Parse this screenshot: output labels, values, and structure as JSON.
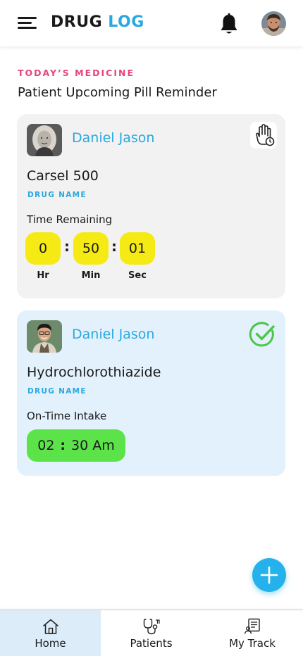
{
  "header": {
    "logo_word1": "DRUG",
    "logo_word2": "LOG",
    "menu_icon": "hamburger-icon",
    "notification_icon": "bell-icon",
    "profile_icon": "user-avatar"
  },
  "section": {
    "kicker": "TODAY’S MEDICINE",
    "title": "Patient Upcoming Pill Reminder"
  },
  "reminders": [
    {
      "patient_name": "Daniel Jason",
      "drug_name": "Carsel 500",
      "drug_label": "DRUG NAME",
      "status_label": "Time Remaining",
      "action_icon": "hand-clock-icon",
      "timer": {
        "hours": "0",
        "minutes": "50",
        "seconds": "01",
        "separator": ":",
        "hours_label": "Hr",
        "minutes_label": "Min",
        "seconds_label": "Sec"
      },
      "card_color": "#f2f2f2"
    },
    {
      "patient_name": "Daniel Jason",
      "drug_name": "Hydrochlorothiazide",
      "drug_label": "DRUG NAME",
      "status_label": "On-Time Intake",
      "action_icon": "check-circle-icon",
      "intake_time": {
        "hour": "02",
        "separator": ":",
        "rest": "30 Am"
      },
      "card_color": "#e3f1fc"
    }
  ],
  "fab": {
    "icon": "plus-icon"
  },
  "bottom_nav": [
    {
      "label": "Home",
      "icon": "home-icon",
      "active": true
    },
    {
      "label": "Patients",
      "icon": "stethoscope-icon",
      "active": false
    },
    {
      "label": "My Track",
      "icon": "report-icon",
      "active": false
    }
  ],
  "colors": {
    "accent_blue": "#2aa8df",
    "accent_pink": "#e8437a",
    "timer_yellow": "#f5ea13",
    "intake_green": "#5ce34a",
    "check_green": "#4cc64a",
    "fab_blue": "#25b2ec",
    "nav_active_bg": "#dcecf9"
  }
}
